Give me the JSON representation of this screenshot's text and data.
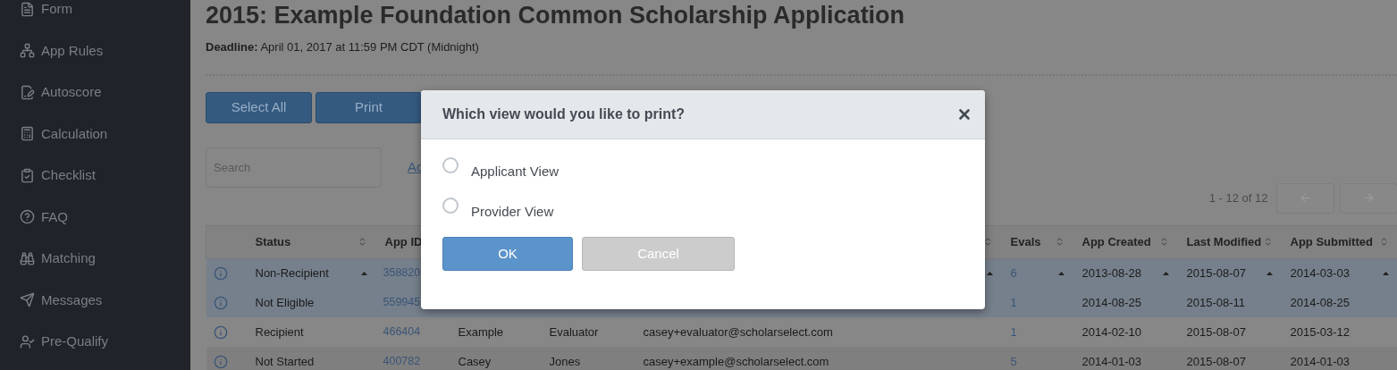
{
  "sidebar": {
    "items": [
      {
        "label": "Form"
      },
      {
        "label": "App Rules"
      },
      {
        "label": "Autoscore"
      },
      {
        "label": "Calculation"
      },
      {
        "label": "Checklist"
      },
      {
        "label": "FAQ"
      },
      {
        "label": "Matching"
      },
      {
        "label": "Messages"
      },
      {
        "label": "Pre-Qualify"
      }
    ]
  },
  "page": {
    "title": "2015: Example Foundation Common Scholarship Application",
    "deadline": "**Deadline:** April 01, 2017 at 11:59 PM CDT (Midnight)"
  },
  "toolbar": {
    "buttons": [
      "Select All",
      "Print"
    ]
  },
  "search": {
    "placeholder": "Search"
  },
  "link": "Ac",
  "pagination": {
    "range": "1 - 12 of 12",
    "prev_disabled": true,
    "next_disabled": true
  },
  "table": {
    "columns": [
      {
        "label": "Status",
        "sortable": true
      },
      {
        "label": "App ID"
      },
      {},
      {},
      {
        "sortable": true
      },
      {
        "label": "Evals",
        "sortable": true
      },
      {
        "label": "App Created",
        "sortable": true
      },
      {
        "label": "Last Modified",
        "sortable": true
      },
      {
        "label": "App Submitted",
        "sortable": true
      }
    ],
    "rows": [
      {
        "selected": true,
        "expanded": true,
        "status": "Non-Recipient",
        "app_id": "358820",
        "evals": "6",
        "app_created": "2013-08-28",
        "last_modified": "2015-08-07",
        "app_submitted": "2014-03-03"
      },
      {
        "selected": true,
        "expanded": false,
        "status": "Not Eligible",
        "app_id": "559945",
        "evals": "1",
        "app_created": "2014-08-25",
        "last_modified": "2015-08-11",
        "app_submitted": "2014-08-25"
      },
      {
        "selected": false,
        "expanded": false,
        "status": "Recipient",
        "app_id": "466404",
        "column_4": "Example",
        "column_5": "Evaluator",
        "column_6": "casey+evaluator@scholarselect.com",
        "evals": "1",
        "app_created": "2014-02-10",
        "last_modified": "2015-08-07",
        "app_submitted": "2015-03-12"
      },
      {
        "selected": false,
        "expanded": false,
        "status": "Not Started",
        "app_id": "400782",
        "column_4": "Casey",
        "column_5": "Jones",
        "column_6": "casey+example@scholarselect.com",
        "evals": "5",
        "app_created": "2014-01-03",
        "last_modified": "2015-08-07",
        "app_submitted": "2014-01-03"
      }
    ]
  },
  "modal": {
    "title": "Which view would you like to print?",
    "options": [
      {
        "label": "Applicant View",
        "selected": false
      },
      {
        "label": "Provider View",
        "selected": false
      }
    ],
    "buttons": [
      {
        "label": "OK",
        "kind": "primary"
      },
      {
        "label": "Cancel",
        "kind": "secondary"
      }
    ]
  }
}
